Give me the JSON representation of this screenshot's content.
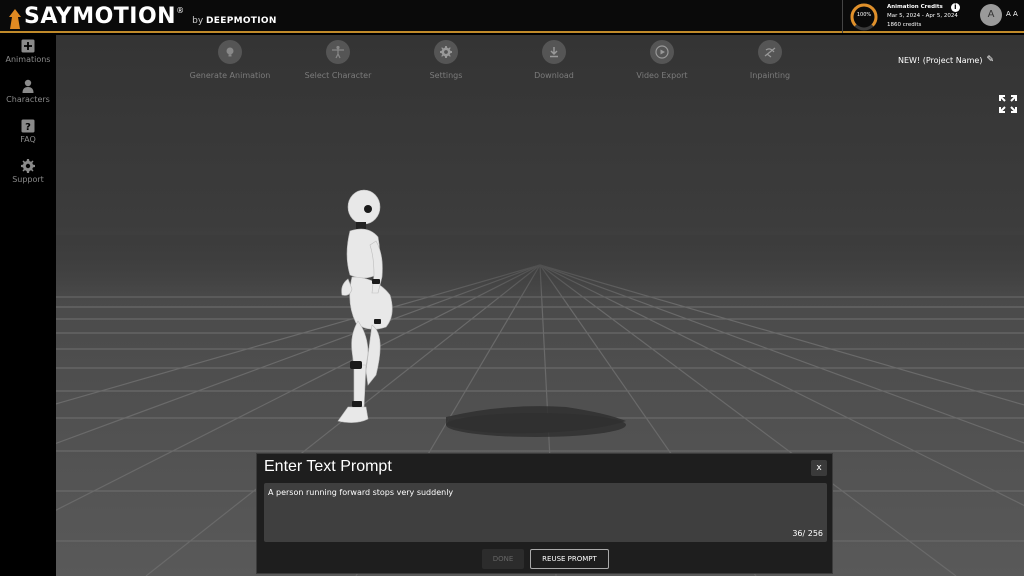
{
  "header": {
    "logo_text": "SAYMOTION",
    "logo_reg": "®",
    "by_text": "by",
    "by_brand": "DEEPMOTION",
    "credits": {
      "gauge_label": "100%",
      "gauge_fraction": 1.0,
      "title": "Animation Credits",
      "date_range": "Mar 5, 2024 - Apr 5, 2024",
      "amount": "1860 credits"
    },
    "avatar_initial": "A",
    "user_initials": "A A"
  },
  "sidebar": {
    "items": [
      {
        "label": "Animations",
        "icon": "plus-square-icon"
      },
      {
        "label": "Characters",
        "icon": "person-icon"
      },
      {
        "label": "FAQ",
        "icon": "question-icon"
      },
      {
        "label": "Support",
        "icon": "gear-icon"
      }
    ]
  },
  "toolbar": {
    "items": [
      {
        "label": "Generate Animation",
        "icon": "lightbulb-icon"
      },
      {
        "label": "Select Character",
        "icon": "figure-icon"
      },
      {
        "label": "Settings",
        "icon": "gear-icon"
      },
      {
        "label": "Download",
        "icon": "download-icon"
      },
      {
        "label": "Video Export",
        "icon": "play-icon"
      },
      {
        "label": "Inpainting",
        "icon": "inpainting-icon"
      }
    ]
  },
  "project": {
    "name": "NEW! (Project Name)",
    "edit_icon": "pencil-icon"
  },
  "dialog": {
    "title": "Enter Text Prompt",
    "close_label": "x",
    "prompt_text": "A person running forward stops very suddenly",
    "char_count": "36/ 256",
    "done_label": "DONE",
    "reuse_label": "REUSE PROMPT"
  },
  "colors": {
    "accent": "#c08a2a",
    "gauge": "#e0902a"
  }
}
